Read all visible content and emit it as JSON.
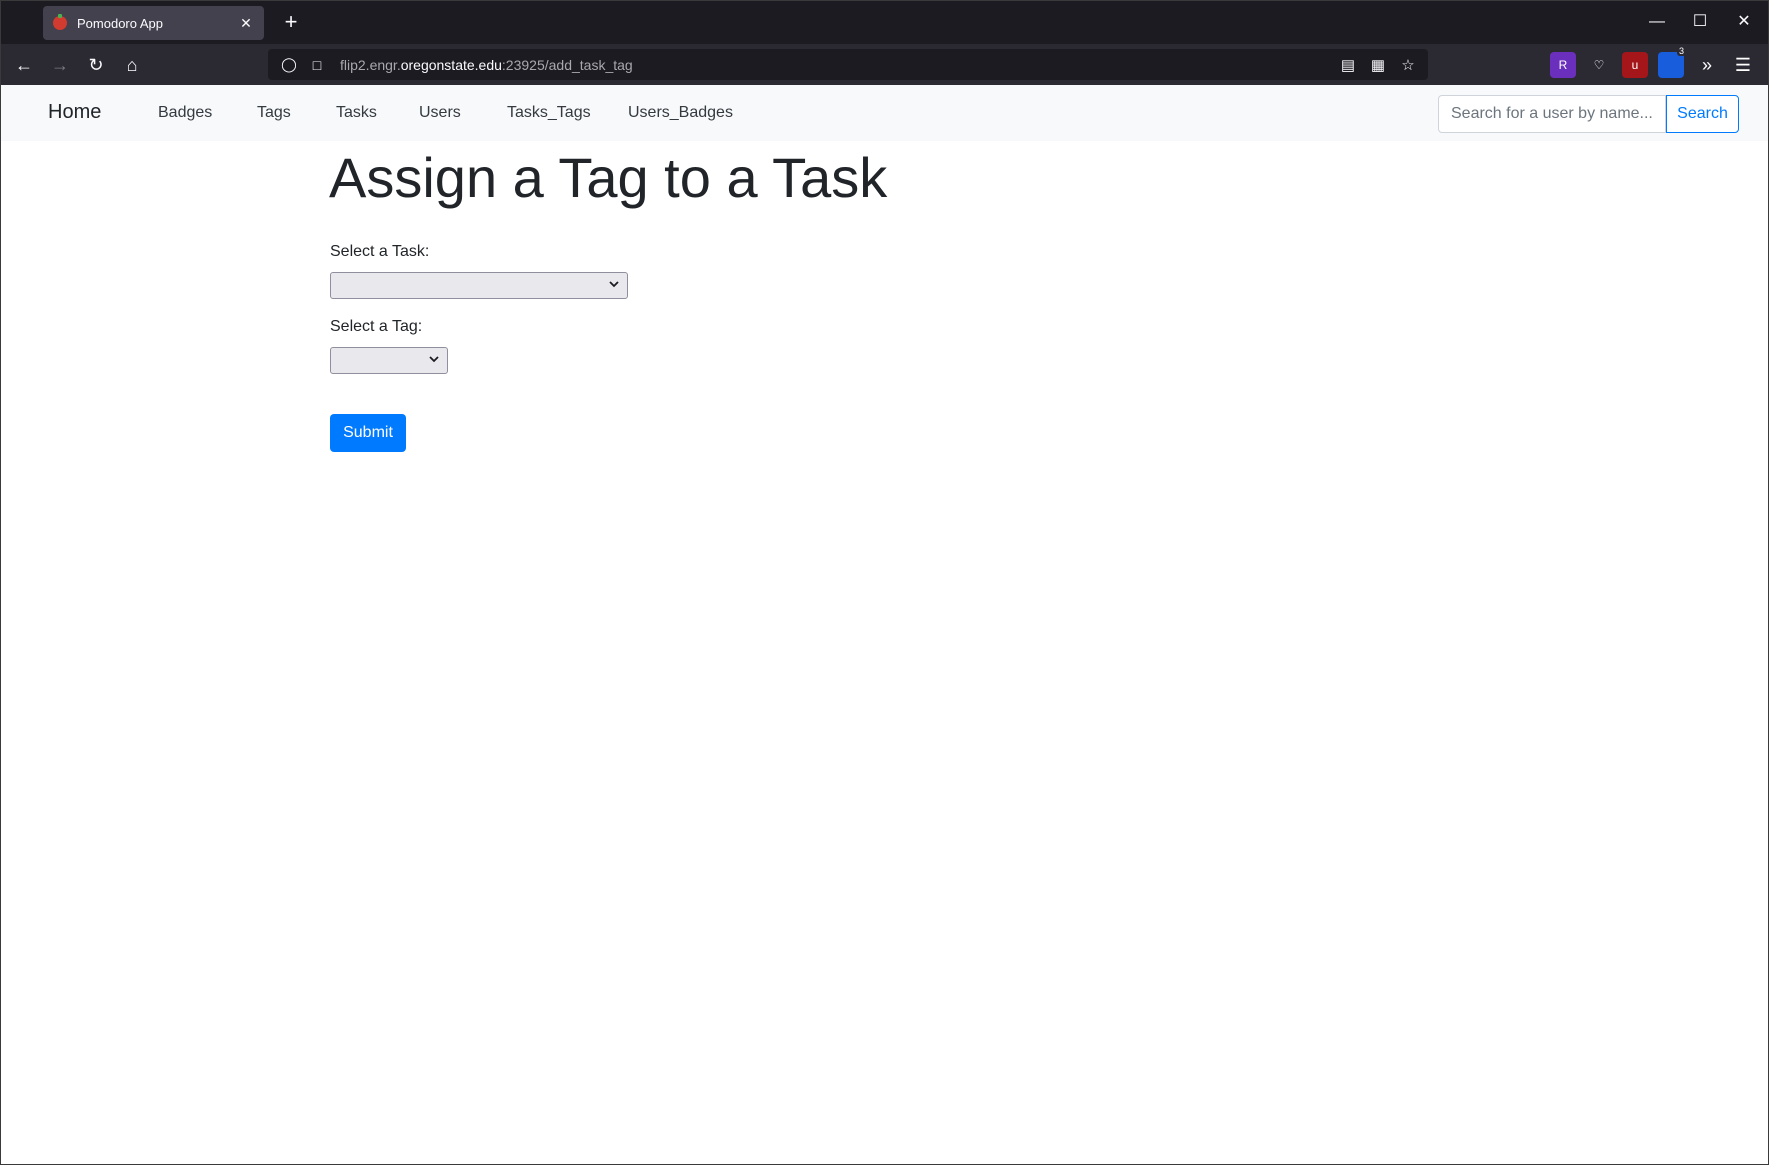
{
  "browser": {
    "tab_title": "Pomodoro App",
    "tab_close": "✕",
    "new_tab": "+",
    "url_prefix": "flip2.engr.",
    "url_domain": "oregonstate.edu",
    "url_suffix": ":23925/add_task_tag",
    "extension_badge": "3"
  },
  "navbar": {
    "brand": "Home",
    "links": [
      "Badges",
      "Tags",
      "Tasks",
      "Users",
      "Tasks_Tags",
      "Users_Badges"
    ],
    "search_placeholder": "Search for a user by name...",
    "search_button": "Search"
  },
  "main": {
    "title": "Assign a Tag to a Task",
    "task_label": "Select a Task:",
    "task_value": "",
    "tag_label": "Select a Tag:",
    "tag_value": "",
    "submit_label": "Submit"
  },
  "colors": {
    "primary": "#007bff",
    "navbar_bg": "#f8f9fa",
    "chrome_dark": "#1c1b22"
  }
}
